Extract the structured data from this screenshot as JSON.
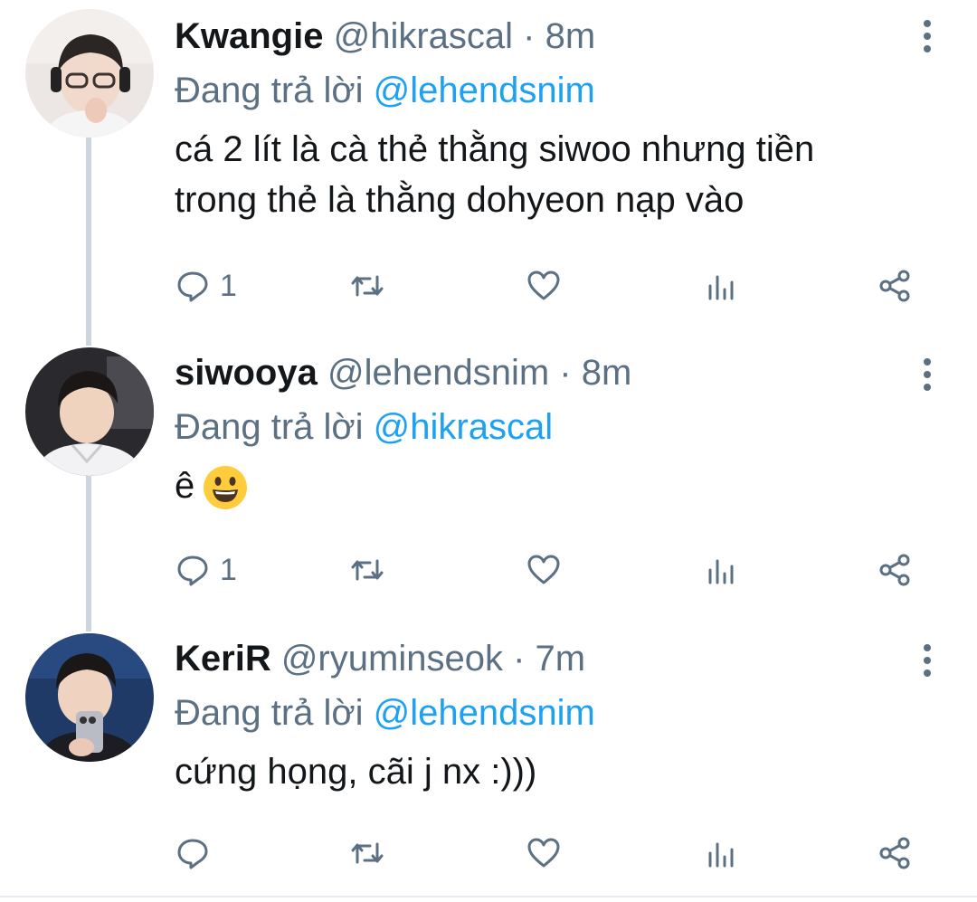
{
  "tweets": [
    {
      "name": "Kwangie",
      "handle": "@hikrascal",
      "separator": "·",
      "time": "8m",
      "reply_prefix": "Đang trả lời",
      "reply_to": "@lehendsnim",
      "text": "cá 2 lít là cà thẻ thằng siwoo nhưng tiền\ntrong thẻ là thằng dohyeon nạp vào",
      "reply_count": "1",
      "avatar_icon": "avatar-photo-glasses-headset"
    },
    {
      "name": "siwooya",
      "handle": "@lehendsnim",
      "separator": "·",
      "time": "8m",
      "reply_prefix": "Đang trả lời",
      "reply_to": "@hikrascal",
      "text": "ê",
      "emoji_icon": "grinning-face-emoji",
      "reply_count": "1",
      "avatar_icon": "avatar-photo-jacket"
    },
    {
      "name": "KeriR",
      "handle": "@ryuminseok",
      "separator": "·",
      "time": "7m",
      "reply_prefix": "Đang trả lời",
      "reply_to": "@lehendsnim",
      "text": "cứng họng, cãi j nx :)))",
      "reply_count": "",
      "avatar_icon": "avatar-photo-phone-selfie"
    }
  ],
  "colors": {
    "link": "#1da1f2",
    "secondary_text": "#5b7083",
    "primary_text": "#14171a",
    "thread_line": "#ccd6dd"
  }
}
